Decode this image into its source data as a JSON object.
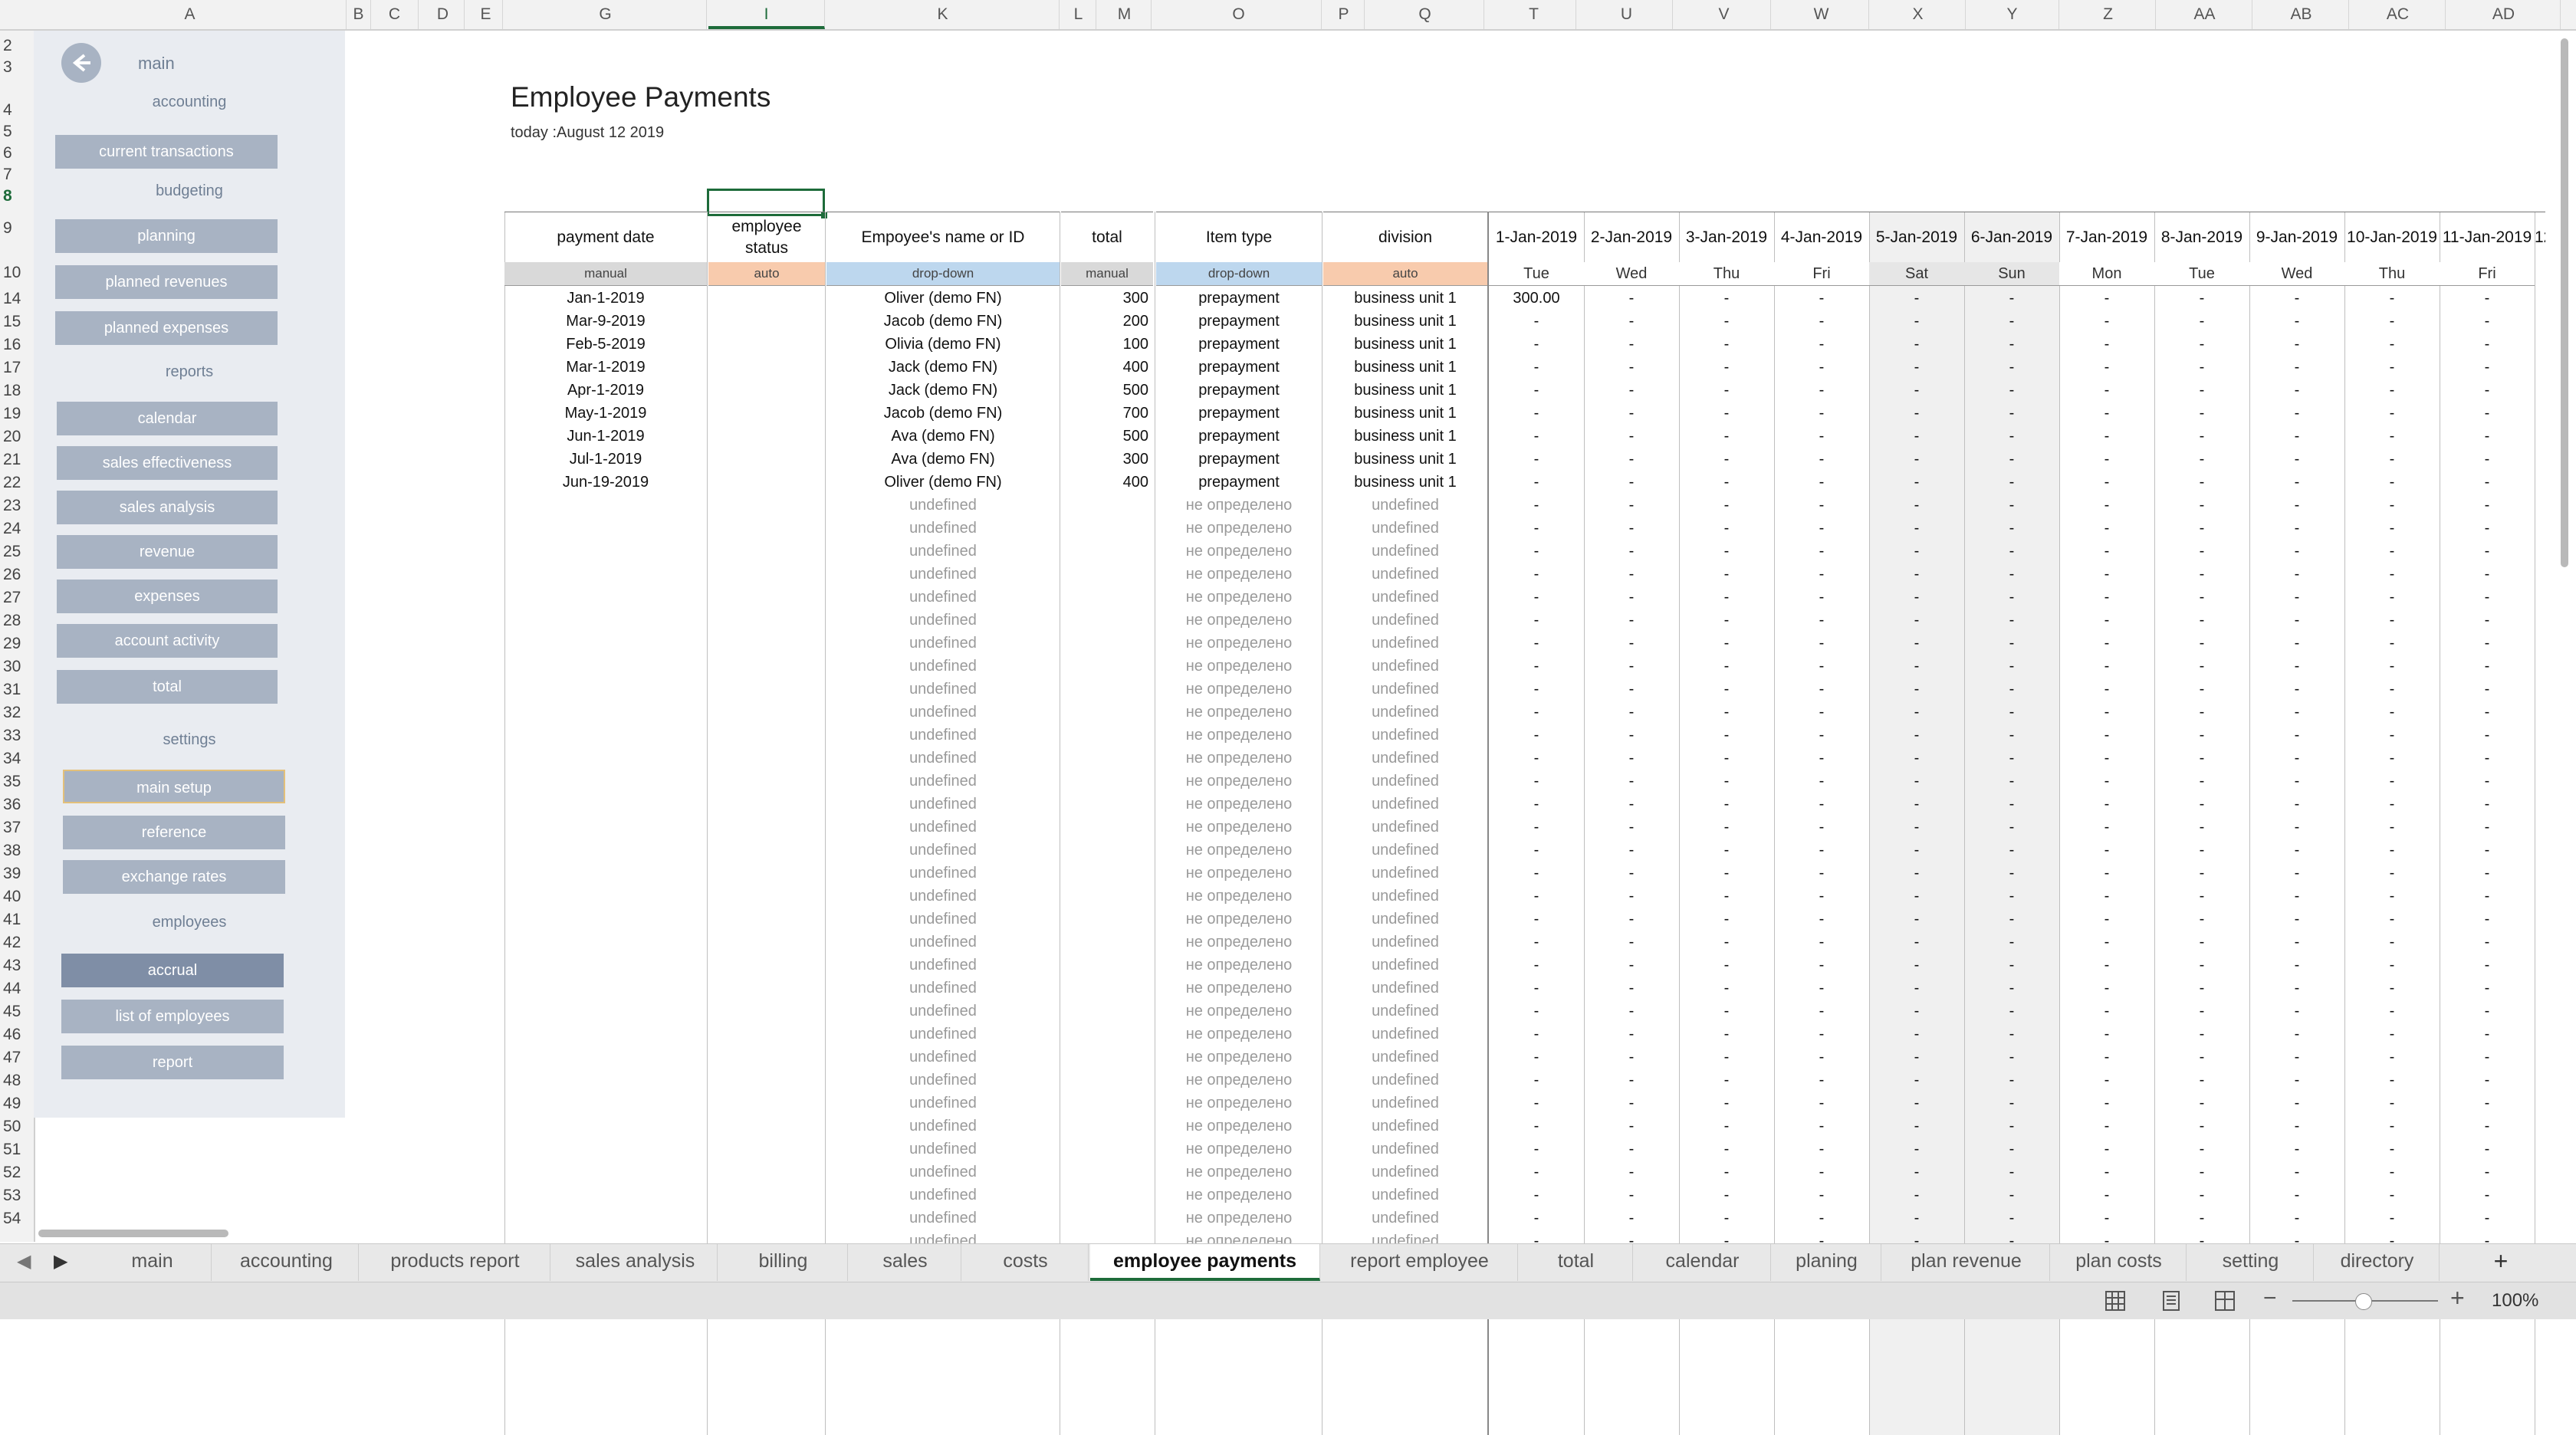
{
  "columns": [
    "A",
    "B",
    "C",
    "D",
    "E",
    "G",
    "I",
    "K",
    "L",
    "M",
    "O",
    "P",
    "Q",
    "T",
    "U",
    "V",
    "W",
    "X",
    "Y",
    "Z",
    "AA",
    "AB",
    "AC",
    "AD"
  ],
  "selected_column": "I",
  "rows": [
    "2",
    "3",
    "4",
    "5",
    "6",
    "7",
    "8",
    "9",
    "10",
    "14",
    "15",
    "16",
    "17",
    "18",
    "19",
    "20",
    "21",
    "22",
    "23",
    "24",
    "25",
    "26",
    "27",
    "28",
    "29",
    "30",
    "31",
    "32",
    "33",
    "34",
    "35",
    "36",
    "37",
    "38",
    "39",
    "40",
    "41",
    "42",
    "43",
    "44",
    "45",
    "46",
    "47",
    "48",
    "49",
    "50",
    "51",
    "52",
    "53",
    "54"
  ],
  "selected_row": "8",
  "sidebar": {
    "main_label": "main",
    "back_icon": "back-arrow-icon",
    "sections": [
      {
        "label": "accounting",
        "buttons": [
          "current transactions"
        ]
      },
      {
        "label": "budgeting",
        "buttons": [
          "planning",
          "planned revenues",
          "planned expenses"
        ]
      },
      {
        "label": "reports",
        "buttons": [
          "calendar",
          "sales effectiveness",
          "sales analysis",
          "revenue",
          "expenses",
          "account activity",
          "total"
        ]
      },
      {
        "label": "settings",
        "buttons": [
          "main setup",
          "reference",
          "exchange rates"
        ]
      },
      {
        "label": "employees",
        "buttons": [
          "accrual",
          "list of employees",
          "report"
        ]
      }
    ]
  },
  "sheet": {
    "title": "Employee Payments",
    "today": "today :August 12 2019"
  },
  "headers": [
    {
      "label": "payment date",
      "tag": "manual",
      "tag_color": "#d9d9d9"
    },
    {
      "label": "employee status",
      "tag": "auto",
      "tag_color": "#f8cbad"
    },
    {
      "label": "Empoyee's name or ID",
      "tag": "drop-down",
      "tag_color": "#bdd7ee"
    },
    {
      "label": "total",
      "tag": "manual",
      "tag_color": "#d9d9d9"
    },
    {
      "label": "Item type",
      "tag": "drop-down",
      "tag_color": "#bdd7ee"
    },
    {
      "label": "division",
      "tag": "auto",
      "tag_color": "#f8cbad"
    }
  ],
  "date_columns": [
    {
      "date": "1-Jan-2019",
      "dow": "Tue"
    },
    {
      "date": "2-Jan-2019",
      "dow": "Wed"
    },
    {
      "date": "3-Jan-2019",
      "dow": "Thu"
    },
    {
      "date": "4-Jan-2019",
      "dow": "Fri"
    },
    {
      "date": "5-Jan-2019",
      "dow": "Sat"
    },
    {
      "date": "6-Jan-2019",
      "dow": "Sun"
    },
    {
      "date": "7-Jan-2019",
      "dow": "Mon"
    },
    {
      "date": "8-Jan-2019",
      "dow": "Tue"
    },
    {
      "date": "9-Jan-2019",
      "dow": "Wed"
    },
    {
      "date": "10-Jan-2019",
      "dow": "Thu"
    },
    {
      "date": "11-Jan-2019",
      "dow": "Fri"
    }
  ],
  "next_date_partial": "12",
  "payments": [
    {
      "date": "Jan-1-2019",
      "name": "Oliver (demo FN)",
      "total": "300",
      "item": "prepayment",
      "division": "business unit 1",
      "first_day": "300.00"
    },
    {
      "date": "Mar-9-2019",
      "name": "Jacob  (demo FN)",
      "total": "200",
      "item": "prepayment",
      "division": "business unit 1",
      "first_day": "-"
    },
    {
      "date": "Feb-5-2019",
      "name": "Olivia (demo FN)",
      "total": "100",
      "item": "prepayment",
      "division": "business unit 1",
      "first_day": "-"
    },
    {
      "date": "Mar-1-2019",
      "name": "Jack (demo FN)",
      "total": "400",
      "item": "prepayment",
      "division": "business unit 1",
      "first_day": "-"
    },
    {
      "date": "Apr-1-2019",
      "name": "Jack (demo FN)",
      "total": "500",
      "item": "prepayment",
      "division": "business unit 1",
      "first_day": "-"
    },
    {
      "date": "May-1-2019",
      "name": "Jacob  (demo FN)",
      "total": "700",
      "item": "prepayment",
      "division": "business unit 1",
      "first_day": "-"
    },
    {
      "date": "Jun-1-2019",
      "name": "Ava (demo FN)",
      "total": "500",
      "item": "prepayment",
      "division": "business unit 1",
      "first_day": "-"
    },
    {
      "date": "Jul-1-2019",
      "name": "Ava (demo FN)",
      "total": "300",
      "item": "prepayment",
      "division": "business unit 1",
      "first_day": "-"
    },
    {
      "date": "Jun-19-2019",
      "name": "Oliver (demo FN)",
      "total": "400",
      "item": "prepayment",
      "division": "business unit 1",
      "first_day": "-"
    }
  ],
  "empty_row": {
    "name": "undefined",
    "item": "не определено",
    "division": "undefined",
    "day": "-"
  },
  "tabs": [
    "main",
    "accounting",
    "products report",
    "sales analysis",
    "billing",
    "sales",
    "costs",
    "employee payments",
    "report employee",
    "total",
    "calendar",
    "planing",
    "plan revenue",
    "plan costs",
    "setting",
    "directory"
  ],
  "active_tab": "employee payments",
  "add_tab": "+",
  "zoom": "100%"
}
